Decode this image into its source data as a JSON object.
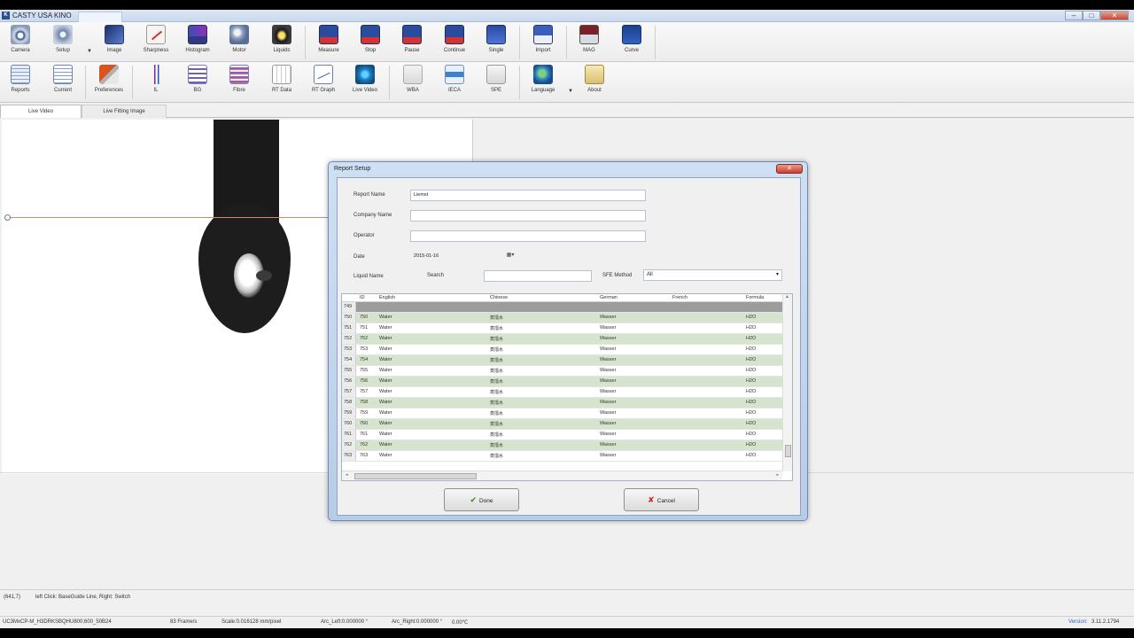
{
  "app": {
    "title": "CASTY USA KINO",
    "icon_letter": "K"
  },
  "window_buttons": [
    "–",
    "□",
    "✕"
  ],
  "toolbar1": [
    {
      "label": "Camera",
      "icon": "camera-icon"
    },
    {
      "label": "Setup",
      "icon": "setup-icon"
    },
    {
      "label": "Image",
      "icon": "image-icon"
    },
    {
      "label": "Sharpness",
      "icon": "sharpness-icon"
    },
    {
      "label": "Histogram",
      "icon": "histogram-icon"
    },
    {
      "label": "Motor",
      "icon": "motor-icon"
    },
    {
      "label": "Liquids",
      "icon": "liquids-icon"
    },
    {
      "label": "Measure",
      "icon": "measure-icon"
    },
    {
      "label": "Stop",
      "icon": "stop-icon"
    },
    {
      "label": "Pause",
      "icon": "pause-icon"
    },
    {
      "label": "Continue",
      "icon": "continue-icon"
    },
    {
      "label": "Single",
      "icon": "single-icon"
    },
    {
      "label": "Import",
      "icon": "import-icon"
    },
    {
      "label": "MAG",
      "icon": "mag-icon"
    },
    {
      "label": "Curve",
      "icon": "curve-icon"
    }
  ],
  "toolbar2": [
    {
      "label": "Reports",
      "icon": "reports-icon"
    },
    {
      "label": "Current",
      "icon": "current-icon"
    },
    {
      "label": "Preferences",
      "icon": "preferences-icon"
    },
    {
      "label": "IL",
      "icon": "il-icon"
    },
    {
      "label": "BG",
      "icon": "bg-icon"
    },
    {
      "label": "Fibre",
      "icon": "fibre-icon"
    },
    {
      "label": "RT Data",
      "icon": "rt-data-icon"
    },
    {
      "label": "RT Graph",
      "icon": "rt-graph-icon"
    },
    {
      "label": "Live Video",
      "icon": "live-video-icon"
    },
    {
      "label": "WBA",
      "icon": "wba-icon"
    },
    {
      "label": "IECA",
      "icon": "ieca-icon"
    },
    {
      "label": "SPE",
      "icon": "spe-icon"
    },
    {
      "label": "Language",
      "icon": "language-icon"
    },
    {
      "label": "About",
      "icon": "about-icon"
    }
  ],
  "tabs": [
    "Live Video",
    "Live Fitting Image"
  ],
  "dialog": {
    "title": "Report Setup",
    "close": "✕",
    "report_name_label": "Report Name",
    "report_name_value": "Liemst",
    "company_name_label": "Company Name",
    "company_name_value": "",
    "operator_label": "Operator",
    "operator_value": "",
    "date_label": "Date",
    "date_value": "2015-01-16",
    "date_button": "▦▾",
    "liquid_name_label": "Liquid Name",
    "search_label": "Search",
    "search_value": "",
    "sfe_method_label": "SFE Method",
    "sfe_method_value": "All",
    "select_arrow": "▾",
    "table": {
      "columns": [
        "ID",
        "English",
        "Chinese",
        "German",
        "French",
        "Formula"
      ],
      "first_row": {
        "row_header": "749"
      },
      "rows": [
        {
          "rh": "750",
          "id": "750",
          "english": "Water",
          "chinese": "蒸馏水",
          "german": "Wasser",
          "french": "",
          "formula": "H2O"
        },
        {
          "rh": "751",
          "id": "751",
          "english": "Water",
          "chinese": "蒸馏水",
          "german": "Wasser",
          "french": "",
          "formula": "H2O"
        },
        {
          "rh": "752",
          "id": "752",
          "english": "Water",
          "chinese": "蒸馏水",
          "german": "Wasser",
          "french": "",
          "formula": "H2O"
        },
        {
          "rh": "753",
          "id": "753",
          "english": "Water",
          "chinese": "蒸馏水",
          "german": "Wasser",
          "french": "",
          "formula": "H2O"
        },
        {
          "rh": "754",
          "id": "754",
          "english": "Water",
          "chinese": "蒸馏水",
          "german": "Wasser",
          "french": "",
          "formula": "H2O"
        },
        {
          "rh": "755",
          "id": "755",
          "english": "Water",
          "chinese": "蒸馏水",
          "german": "Wasser",
          "french": "",
          "formula": "H2O"
        },
        {
          "rh": "756",
          "id": "756",
          "english": "Water",
          "chinese": "蒸馏水",
          "german": "Wasser",
          "french": "",
          "formula": "H2O"
        },
        {
          "rh": "757",
          "id": "757",
          "english": "Water",
          "chinese": "蒸馏水",
          "german": "Wasser",
          "french": "",
          "formula": "H2O"
        },
        {
          "rh": "758",
          "id": "758",
          "english": "Water",
          "chinese": "蒸馏水",
          "german": "Wasser",
          "french": "",
          "formula": "H2O"
        },
        {
          "rh": "759",
          "id": "759",
          "english": "Water",
          "chinese": "蒸馏水",
          "german": "Wasser",
          "french": "",
          "formula": "H2O"
        },
        {
          "rh": "760",
          "id": "760",
          "english": "Water",
          "chinese": "蒸馏水",
          "german": "Wasser",
          "french": "",
          "formula": "H2O"
        },
        {
          "rh": "761",
          "id": "761",
          "english": "Water",
          "chinese": "蒸馏水",
          "german": "Wasser",
          "french": "",
          "formula": "H2O"
        },
        {
          "rh": "762",
          "id": "762",
          "english": "Water",
          "chinese": "蒸馏水",
          "german": "Wasser",
          "french": "",
          "formula": "H2O"
        },
        {
          "rh": "763",
          "id": "763",
          "english": "Water",
          "chinese": "蒸馏水",
          "german": "Wasser",
          "french": "",
          "formula": "H2O"
        }
      ]
    },
    "done_label": "Done",
    "cancel_label": "Cancel"
  },
  "status": {
    "coords": "(641,7)",
    "hint": "left Click: BaseGuide Line, Right: Switch",
    "camera": "UC3MxCP-M_H3DRKSBQHU800;600_50B24",
    "fps": "83  Frame/s",
    "scale": "Scale:0.016128 mm/pixel",
    "arc_left": "Arc_Left:0.000000 °",
    "arc_right": "Arc_Right:0.000000 °",
    "temp": "0.00℃",
    "version_label": "Version:",
    "version": "3.11.2.1794"
  },
  "colors": {
    "row_green": "#d4e4cd",
    "accent": "#2a4e92",
    "close_red": "#c9402a"
  }
}
